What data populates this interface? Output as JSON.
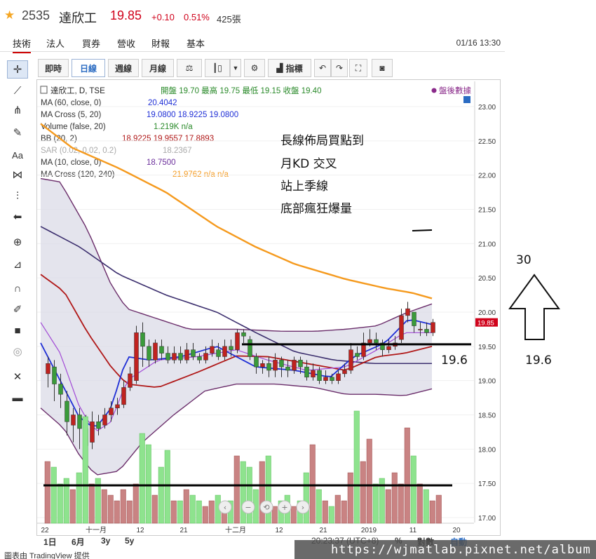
{
  "header": {
    "code": "2535",
    "name": "達欣工",
    "price": "19.85",
    "change": "+0.10",
    "pct": "0.51%",
    "volume": "425張"
  },
  "tabs": [
    "技術",
    "法人",
    "營收",
    "營收",
    "財報",
    "基本"
  ],
  "tabs_real": [
    "技術",
    "法人",
    "買券",
    "營收",
    "財報",
    "基本"
  ],
  "timestamp": "01/16 13:30",
  "toolbar": {
    "periods": [
      "即時",
      "日線",
      "週線",
      "月線"
    ],
    "indicators_label": "指標"
  },
  "legend": {
    "title": "達欣工, D, TSE",
    "ohlc": "開盤 19.70 最高 19.75 最低 19.15 收盤 19.40",
    "after_hours": "盤後數據",
    "rows": [
      {
        "label": "MA (60, close, 0)",
        "values": "20.4042"
      },
      {
        "label": "MA Cross (5, 20)",
        "values": "19.0800 18.9225 19.0800"
      },
      {
        "label": "Volume (false, 20)",
        "values": "1.219K n/a"
      },
      {
        "label": "BB (20, 2)",
        "values": "18.9225 19.9557 17.8893"
      },
      {
        "label": "SAR (0.02, 0.02, 0.2)",
        "values": "18.2367"
      },
      {
        "label": "MA (10, close, 0)",
        "values": "18.7500"
      },
      {
        "label": "MA Cross (120, 240)",
        "values": "21.9762 n/a n/a"
      }
    ]
  },
  "annotation": {
    "lines": [
      "長線佈局買點到",
      "月KD 交叉",
      "站上季線",
      "底部瘋狂爆量"
    ],
    "level_label": "19.6",
    "arrow_top": "30",
    "arrow_bottom": "19.6"
  },
  "price_axis": [
    "23.00",
    "22.50",
    "22.00",
    "21.50",
    "21.00",
    "20.50",
    "20.00",
    "19.50",
    "19.00",
    "18.50",
    "18.00",
    "17.50",
    "17.00"
  ],
  "price_tag": "19.85",
  "time_axis": [
    "22",
    "十一月",
    "12",
    "21",
    "十二月",
    "12",
    "21",
    "2019",
    "11",
    "20"
  ],
  "bottom_bar": {
    "ranges": [
      "1日",
      "6月",
      "3y",
      "5y"
    ],
    "clock": "20:23:37 (UTC+8)",
    "pct": "%",
    "log": "對數",
    "auto": "自動"
  },
  "footer": {
    "credit": "圖表由 TradingView 提供",
    "watermark": "https://wjmatlab.pixnet.net/album"
  },
  "colors": {
    "up": "#c0221f",
    "down": "#3a9b3a",
    "ma60": "#f59a1e",
    "ma_blue": "#1f2fd6",
    "ma_red": "#b01818",
    "bb": "#6b2e6b",
    "purple_line": "#3c2f6e"
  }
}
